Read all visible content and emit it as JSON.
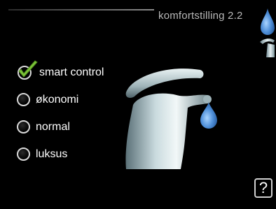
{
  "header": {
    "title": "komfortstilling 2.2"
  },
  "options": [
    {
      "label": "smart control",
      "selected": true
    },
    {
      "label": "økonomi",
      "selected": false
    },
    {
      "label": "normal",
      "selected": false
    },
    {
      "label": "luksus",
      "selected": false
    }
  ],
  "help": {
    "label": "?"
  },
  "icons": {
    "header": "water-drop-icon",
    "side": "faucet-small-icon",
    "main": "faucet-icon",
    "selected": "checkmark-icon"
  },
  "colors": {
    "background": "#000000",
    "accent_green": "#7cc33a",
    "drop_blue": "#3f7fc4",
    "text": "#ffffff"
  }
}
